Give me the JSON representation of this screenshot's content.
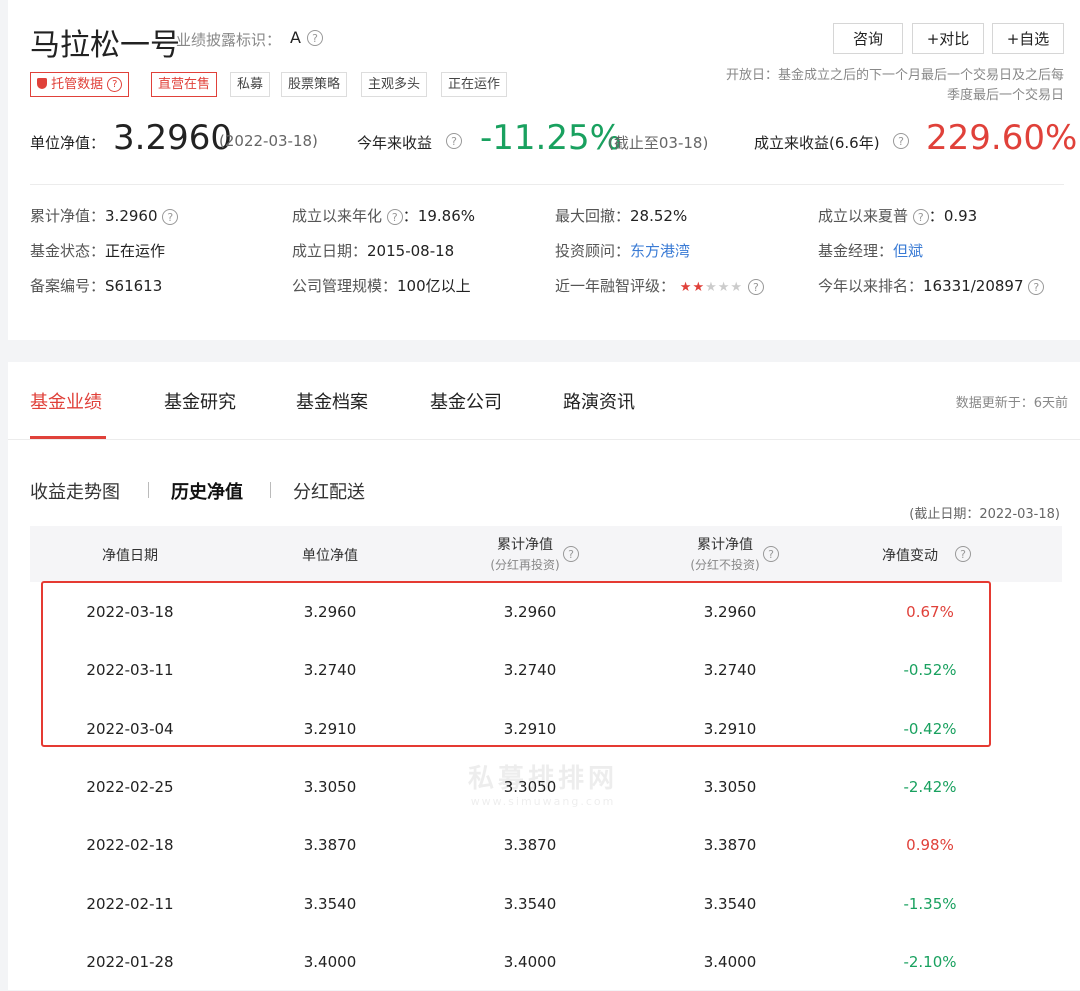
{
  "fund": {
    "name": "马拉松一号",
    "disclosure_label": "业绩披露标识：",
    "disclosure_value": "A",
    "tags": [
      "托管数据",
      "直营在售",
      "私募",
      "股票策略",
      "主观多头",
      "正在运作"
    ],
    "buttons": [
      "咨询",
      "+对比",
      "+自选"
    ],
    "open_day_label": "开放日：",
    "open_day_line1": "基金成立之后的下一个月最后一个交易日及之后每",
    "open_day_line2": "季度最后一个交易日"
  },
  "headline": {
    "nav_label": "单位净值：",
    "nav_value": "3.2960",
    "nav_date": "(2022-03-18)",
    "ytd_label": "今年来收益",
    "ytd_value": "-11.25%",
    "ytd_note": "(截止至03-18)",
    "since_label": "成立来收益(6.6年)",
    "since_value": "229.60%"
  },
  "info": {
    "cum_nav_label": "累计净值：",
    "cum_nav_value": "3.2960",
    "status_label": "基金状态：",
    "status_value": "正在运作",
    "record_label": "备案编号：",
    "record_value": "S61613",
    "annual_label": "成立以来年化",
    "annual_value": "19.86%",
    "setup_label": "成立日期：",
    "setup_value": "2015-08-18",
    "scale_label": "公司管理规模：",
    "scale_value": "100亿以上",
    "drawdown_label": "最大回撤：",
    "drawdown_value": "28.52%",
    "advisor_label": "投资顾问：",
    "advisor_value": "东方港湾",
    "rating_label": "近一年融智评级：",
    "rating_stars": 2,
    "rating_max": 5,
    "sharpe_label": "成立以来夏普",
    "sharpe_value": "0.93",
    "manager_label": "基金经理：",
    "manager_value": "但斌",
    "rank_label": "今年以来排名：",
    "rank_value": "16331/20897"
  },
  "tabs": [
    "基金业绩",
    "基金研究",
    "基金档案",
    "基金公司",
    "路演资讯"
  ],
  "update_label": "数据更新于：",
  "update_value": "6天前",
  "subtabs": [
    "收益走势图",
    "历史净值",
    "分红配送"
  ],
  "cutoff": "(截止日期：2022-03-18)",
  "table": {
    "headers": [
      {
        "main": "净值日期",
        "sub": ""
      },
      {
        "main": "单位净值",
        "sub": ""
      },
      {
        "main": "累计净值",
        "sub": "(分红再投资)"
      },
      {
        "main": "累计净值",
        "sub": "(分红不投资)"
      },
      {
        "main": "净值变动",
        "sub": ""
      }
    ],
    "rows": [
      {
        "date": "2022-03-18",
        "nav": "3.2960",
        "cum_reinvest": "3.2960",
        "cum_no_reinvest": "3.2960",
        "change": "0.67%"
      },
      {
        "date": "2022-03-11",
        "nav": "3.2740",
        "cum_reinvest": "3.2740",
        "cum_no_reinvest": "3.2740",
        "change": "-0.52%"
      },
      {
        "date": "2022-03-04",
        "nav": "3.2910",
        "cum_reinvest": "3.2910",
        "cum_no_reinvest": "3.2910",
        "change": "-0.42%"
      },
      {
        "date": "2022-02-25",
        "nav": "3.3050",
        "cum_reinvest": "3.3050",
        "cum_no_reinvest": "3.3050",
        "change": "-2.42%"
      },
      {
        "date": "2022-02-18",
        "nav": "3.3870",
        "cum_reinvest": "3.3870",
        "cum_no_reinvest": "3.3870",
        "change": "0.98%"
      },
      {
        "date": "2022-02-11",
        "nav": "3.3540",
        "cum_reinvest": "3.3540",
        "cum_no_reinvest": "3.3540",
        "change": "-1.35%"
      },
      {
        "date": "2022-01-28",
        "nav": "3.4000",
        "cum_reinvest": "3.4000",
        "cum_no_reinvest": "3.4000",
        "change": "-2.10%"
      }
    ]
  },
  "watermark": {
    "cn": "私募排排网",
    "en": "www.simuwang.com"
  },
  "colors": {
    "red": "#e0413a",
    "green": "#19a15f",
    "blue": "#3a7bd5",
    "highlight": "#e53a32"
  }
}
